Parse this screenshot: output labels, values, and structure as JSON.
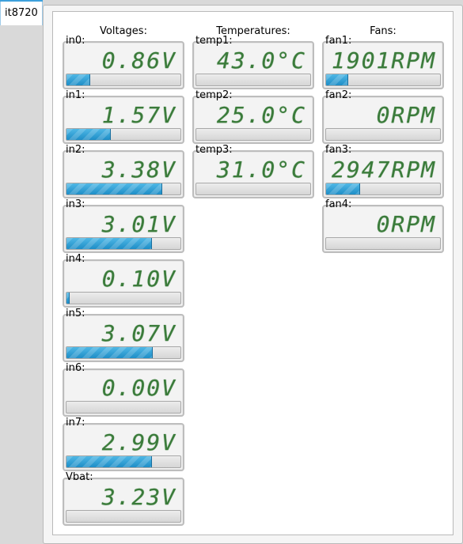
{
  "tab": {
    "label": "it8720"
  },
  "headers": {
    "voltages": "Voltages:",
    "temperatures": "Temperatures:",
    "fans": "Fans:"
  },
  "voltages": [
    {
      "label": "in0:",
      "value": "0.86V",
      "level": 0.2
    },
    {
      "label": "in1:",
      "value": "1.57V",
      "level": 0.38
    },
    {
      "label": "in2:",
      "value": "3.38V",
      "level": 0.83
    },
    {
      "label": "in3:",
      "value": "3.01V",
      "level": 0.74
    },
    {
      "label": "in4:",
      "value": "0.10V",
      "level": 0.02
    },
    {
      "label": "in5:",
      "value": "3.07V",
      "level": 0.75
    },
    {
      "label": "in6:",
      "value": "0.00V",
      "level": 0.0
    },
    {
      "label": "in7:",
      "value": "2.99V",
      "level": 0.74
    },
    {
      "label": "Vbat:",
      "value": "3.23V",
      "level": 0.0
    }
  ],
  "temperatures": [
    {
      "label": "temp1:",
      "value": "43.0°C",
      "level": 0.0
    },
    {
      "label": "temp2:",
      "value": "25.0°C",
      "level": 0.0
    },
    {
      "label": "temp3:",
      "value": "31.0°C",
      "level": 0.0
    }
  ],
  "fans": [
    {
      "label": "fan1:",
      "value": "1901RPM",
      "level": 0.19
    },
    {
      "label": "fan2:",
      "value": "0RPM",
      "level": 0.0
    },
    {
      "label": "fan3:",
      "value": "2947RPM",
      "level": 0.29
    },
    {
      "label": "fan4:",
      "value": "0RPM",
      "level": 0.0
    }
  ],
  "colors": {
    "lcd_text": "#3b7b3b",
    "bar_fill": "#2a9ad4",
    "tab_accent": "#3da0dc"
  }
}
